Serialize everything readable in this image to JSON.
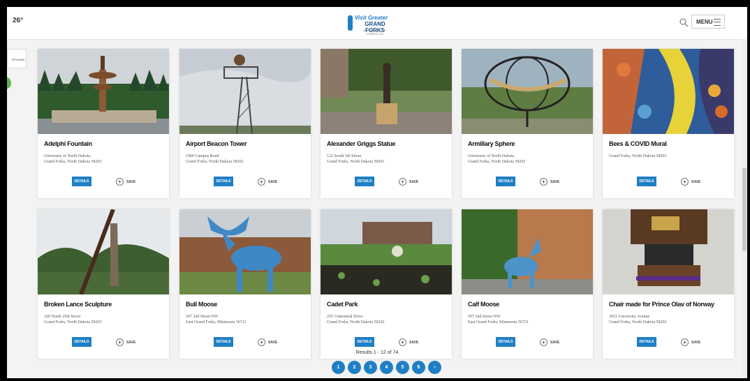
{
  "header": {
    "weather": "26°",
    "logo_line1": "Visit Greater",
    "logo_line2": "GRAND FORKS",
    "logo_line3": "NORTH DAKOTA • MINNESOTA",
    "menu_label": "MENU"
  },
  "sidebar": {
    "tab_label": "OPTIONS"
  },
  "cards": [
    {
      "title": "Adelphi Fountain",
      "addr1": "University of North Dakota",
      "addr2": "Grand Forks, North Dakota 58202",
      "details": "DETAILS",
      "save": "SAVE"
    },
    {
      "title": "Airport Beacon Tower",
      "addr1": "1960 Campus Road",
      "addr2": "Grand Forks, North Dakota 58202",
      "details": "DETAILS",
      "save": "SAVE"
    },
    {
      "title": "Alexander Griggs Statue",
      "addr1": "122 South 5th Street",
      "addr2": "Grand Forks, North Dakota 58201",
      "details": "DETAILS",
      "save": "SAVE"
    },
    {
      "title": "Armillary Sphere",
      "addr1": "University of North Dakota",
      "addr2": "Grand Forks, North Dakota 58202",
      "details": "DETAILS",
      "save": "SAVE"
    },
    {
      "title": "Bees & COVID Mural",
      "addr1": "",
      "addr2": "Grand Forks, North Dakota 58201",
      "details": "DETAILS",
      "save": "SAVE"
    },
    {
      "title": "Broken Lance Sculpture",
      "addr1": "320 North 25th Street",
      "addr2": "Grand Forks, North Dakota 58203",
      "details": "DETAILS",
      "save": "SAVE"
    },
    {
      "title": "Bull Moose",
      "addr1": "507 2nd Street NW",
      "addr2": "East Grand Forks, Minnesota 56721",
      "details": "DETAILS",
      "save": "SAVE"
    },
    {
      "title": "Cadet Park",
      "addr1": "255 Centennial Drive",
      "addr2": "Grand Forks, North Dakota 58202",
      "details": "DETAILS",
      "save": "SAVE"
    },
    {
      "title": "Calf Moose",
      "addr1": "507 2nd Street NW",
      "addr2": "East Grand Forks, Minnesota 56721",
      "details": "DETAILS",
      "save": "SAVE"
    },
    {
      "title": "Chair made for Prince Olav of Norway",
      "addr1": "3051 University Avenue",
      "addr2": "Grand Forks, North Dakota 58202",
      "details": "DETAILS",
      "save": "SAVE"
    }
  ],
  "results": "Results 1 - 12 of 74",
  "pagination": [
    "1",
    "2",
    "3",
    "4",
    "5",
    "6",
    "›"
  ],
  "colors": {
    "accent": "#1e7fc4",
    "green": "#66b24a"
  }
}
